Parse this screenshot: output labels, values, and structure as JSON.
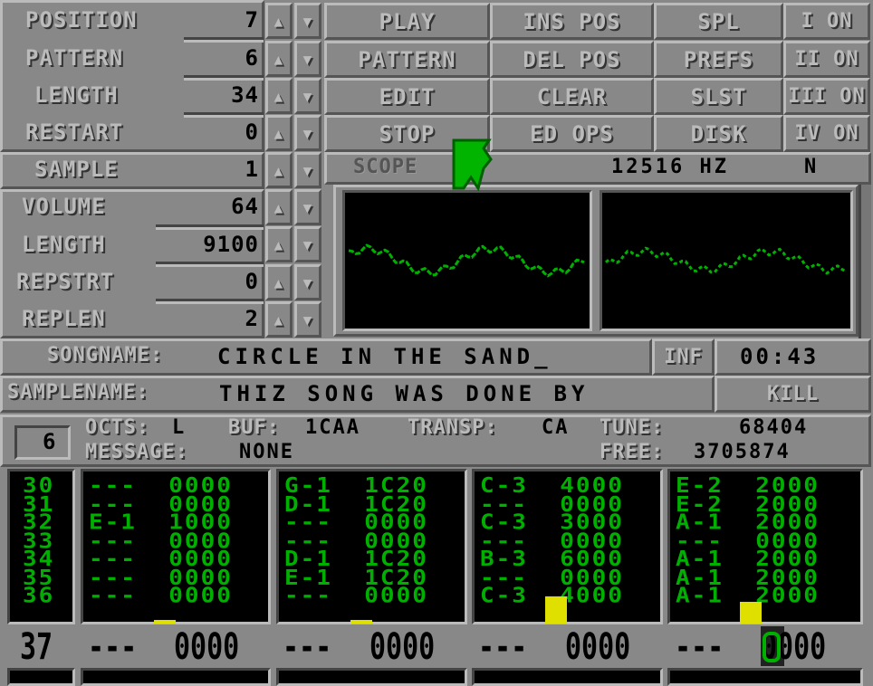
{
  "song_panel": {
    "rows": [
      {
        "label": "POSITION",
        "value": "7"
      },
      {
        "label": "PATTERN",
        "value": "6"
      },
      {
        "label": "LENGTH",
        "value": "34"
      },
      {
        "label": "RESTART",
        "value": "0"
      }
    ]
  },
  "sample_panel": {
    "rows": [
      {
        "label": "SAMPLE",
        "value": "1"
      },
      {
        "label": "VOLUME",
        "value": "64"
      },
      {
        "label": "LENGTH",
        "value": "9100"
      },
      {
        "label": "REPSTRT",
        "value": "0"
      },
      {
        "label": "REPLEN",
        "value": "2"
      }
    ]
  },
  "arrows": {
    "up": "▲",
    "down": "▼"
  },
  "buttons": {
    "col1": [
      "PLAY",
      "PATTERN",
      "EDIT",
      "STOP"
    ],
    "col2": [
      "INS POS",
      "DEL POS",
      "CLEAR",
      "ED OPS"
    ],
    "col3": [
      "SPL",
      "PREFS",
      "SLST",
      "DISK"
    ],
    "channels": [
      "I ON",
      "II ON",
      "III ON",
      "IV ON"
    ]
  },
  "scope": {
    "label": "SCOPE",
    "frequency": "12516 HZ",
    "mode": "N",
    "trace_color": "#00b000"
  },
  "song": {
    "songname_label": "SONGNAME:",
    "songname_value": "CIRCLE IN THE SAND_",
    "inf_label": "INF",
    "time": "00:43",
    "samplename_label": "SAMPLENAME:",
    "samplename_value": "THIZ SONG WAS DONE BY",
    "kill_label": "KILL"
  },
  "status": {
    "octave_box": "6",
    "octs_label": "OCTS:",
    "octs_value": "L",
    "buf_label": "BUF:",
    "buf_value": "1CAA",
    "transp_label": "TRANSP:",
    "transp_value": "CA",
    "tune_label": "TUNE:",
    "tune_value": "68404",
    "message_label": "MESSAGE:",
    "message_value": "NONE",
    "free_label": "FREE:",
    "free_value": "3705874"
  },
  "pattern": {
    "rows": [
      "30",
      "31",
      "32",
      "33",
      "34",
      "35",
      "36"
    ],
    "channels": [
      {
        "notes": [
          "---",
          "---",
          "E-1",
          "---",
          "---",
          "---",
          "---"
        ],
        "effects": [
          "0000",
          "0000",
          "1000",
          "0000",
          "0000",
          "0000",
          "0000"
        ]
      },
      {
        "notes": [
          "G-1",
          "D-1",
          "---",
          "---",
          "D-1",
          "E-1",
          "---"
        ],
        "effects": [
          "1C20",
          "1C20",
          "0000",
          "0000",
          "1C20",
          "1C20",
          "0000"
        ]
      },
      {
        "notes": [
          "C-3",
          "---",
          "C-3",
          "---",
          "B-3",
          "---",
          "C-3"
        ],
        "effects": [
          "4000",
          "0000",
          "3000",
          "0000",
          "6000",
          "0000",
          "4000"
        ]
      },
      {
        "notes": [
          "E-2",
          "E-2",
          "A-1",
          "---",
          "A-1",
          "A-1",
          "A-1"
        ],
        "effects": [
          "2000",
          "2000",
          "2000",
          "0000",
          "2000",
          "2000",
          "2000"
        ]
      }
    ],
    "current_row": {
      "index": "37",
      "channels": [
        {
          "note": "---",
          "effect": "0000"
        },
        {
          "note": "---",
          "effect": "0000"
        },
        {
          "note": "---",
          "effect": "0000"
        },
        {
          "note": "---",
          "effect": "0000"
        }
      ]
    },
    "highlight_color": "#e0e000"
  }
}
